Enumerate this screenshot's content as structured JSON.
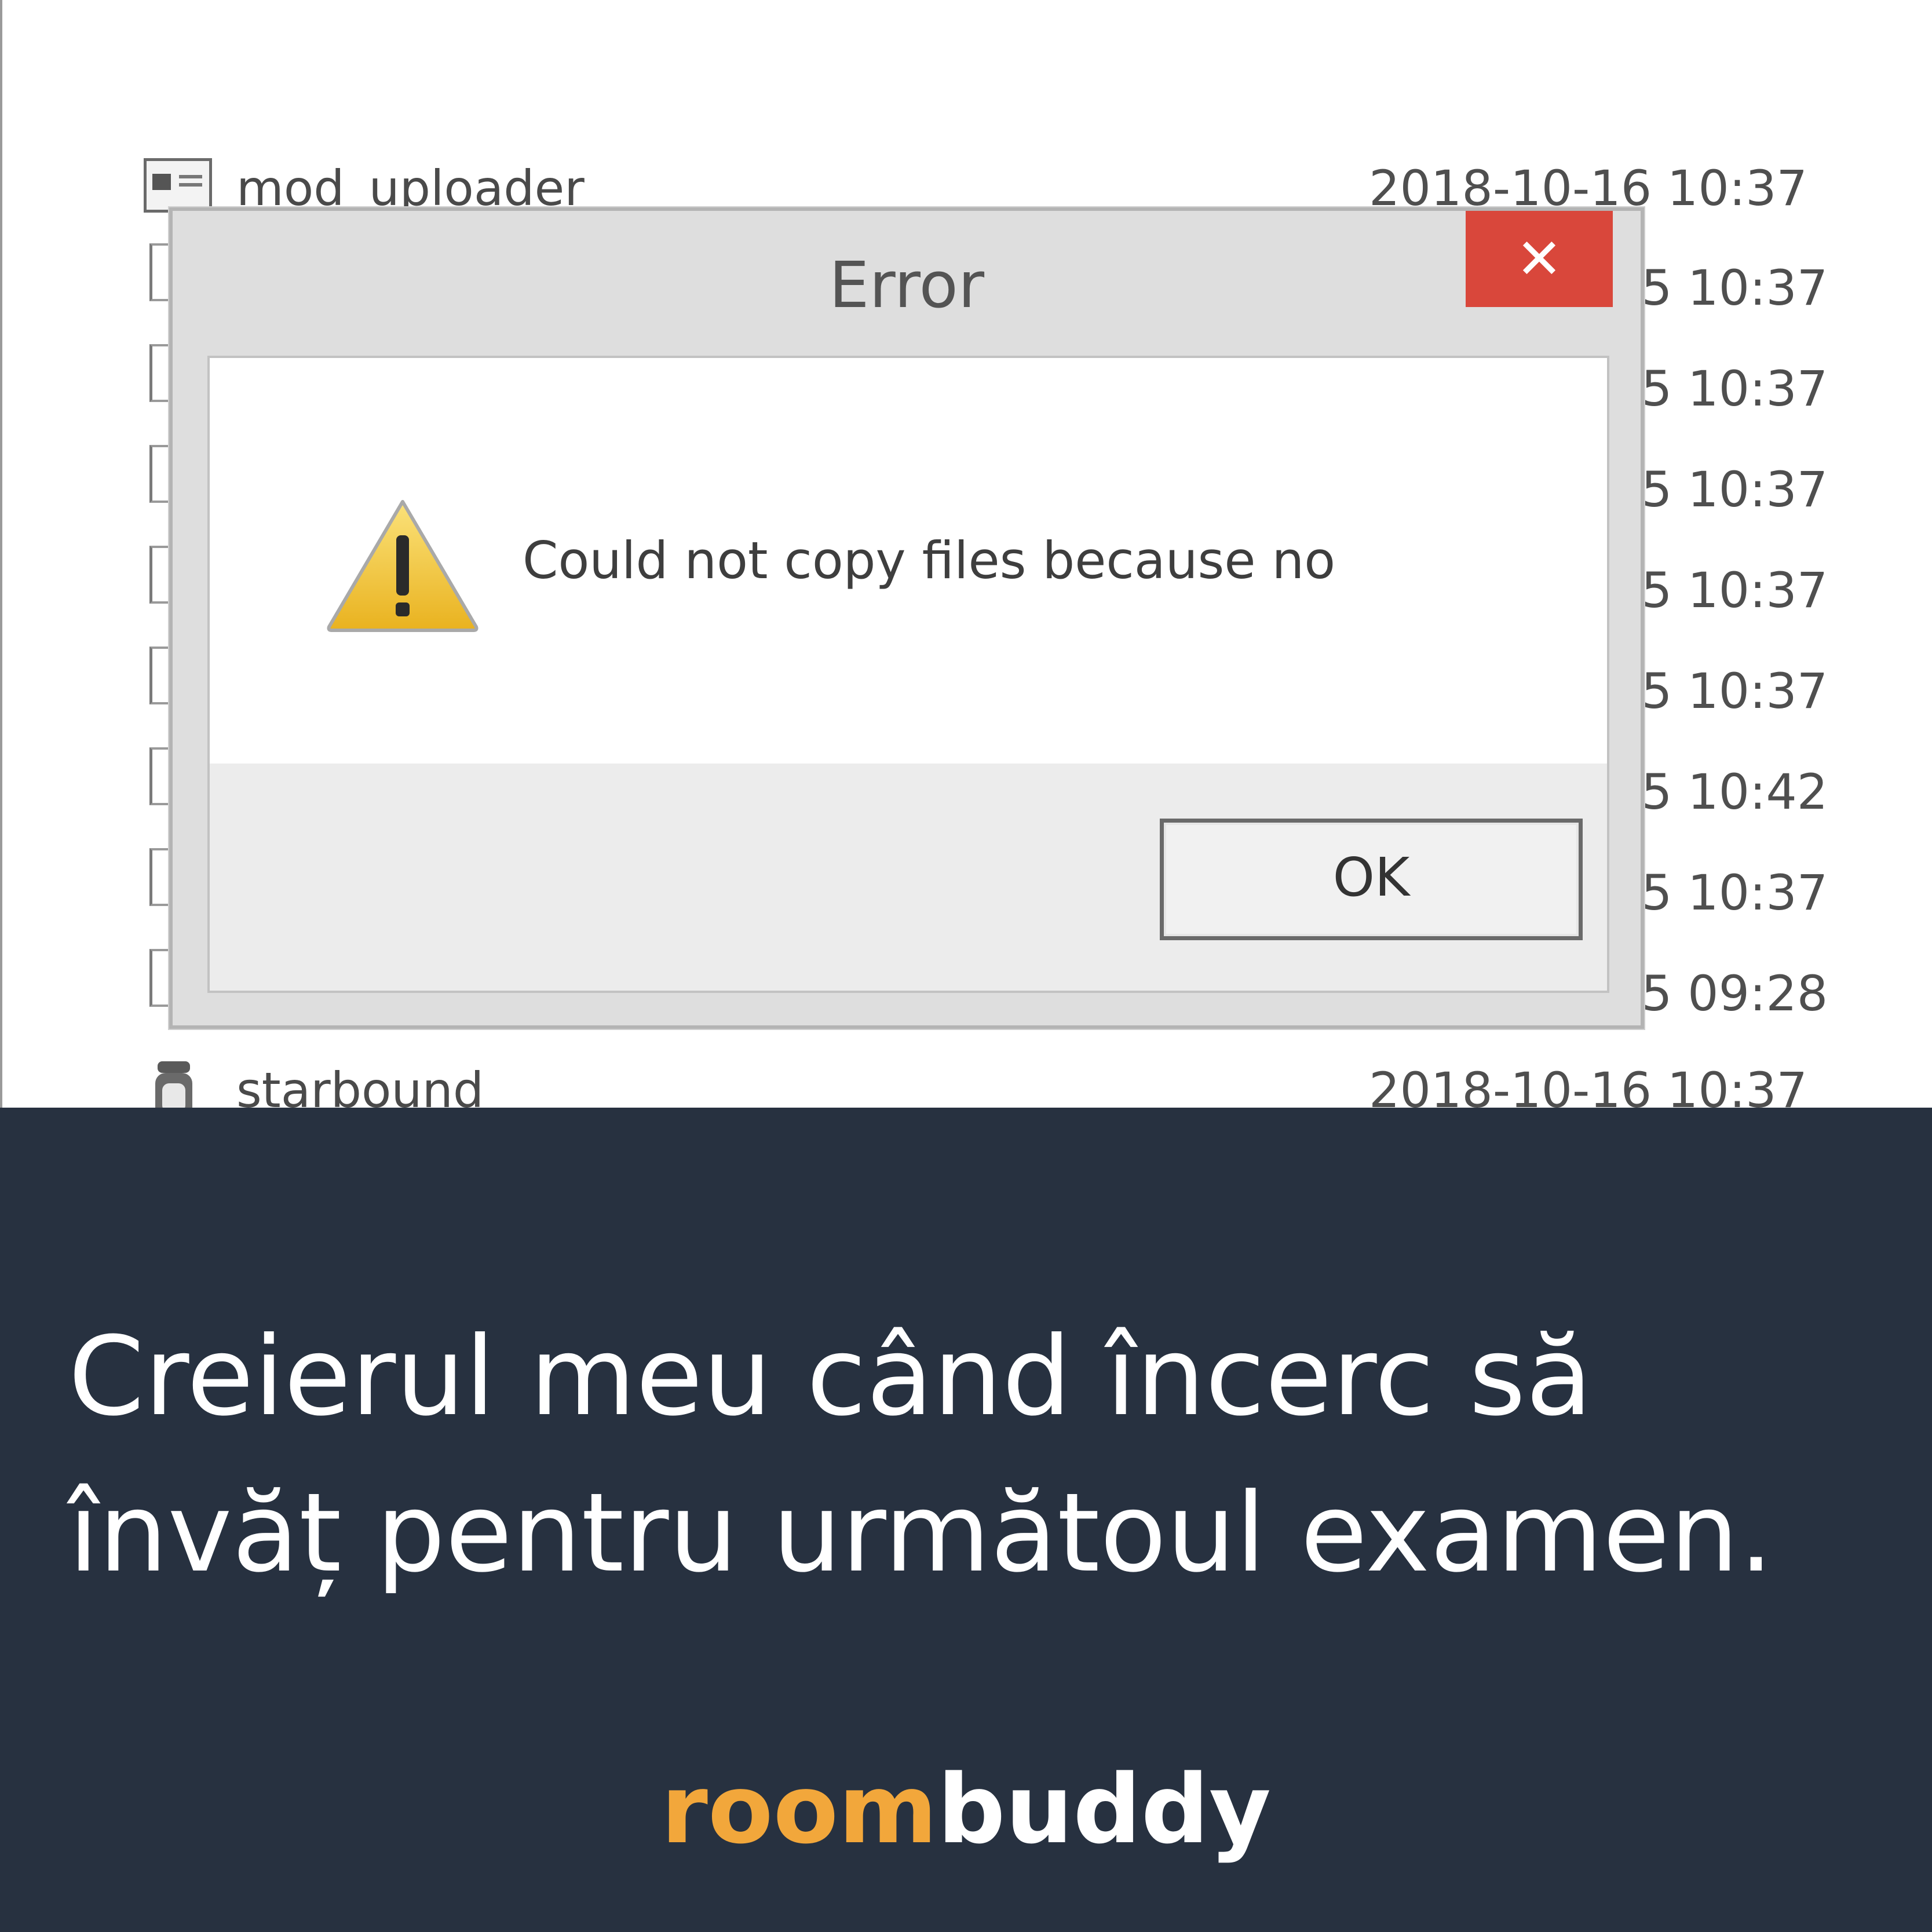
{
  "file_list": {
    "top_row": {
      "name": "mod_uploader",
      "date": "2018-10-16 10:37"
    },
    "bottom_row": {
      "name": "starbound",
      "date": "2018-10-16 10:37"
    },
    "partial_dates": [
      "5 10:37",
      "5 10:37",
      "5 10:37",
      "5 10:37",
      "5 10:37",
      "5 10:42",
      "5 10:37",
      "5 09:28"
    ]
  },
  "dialog": {
    "title": "Error",
    "close_glyph": "✕",
    "icon": "warning-icon",
    "message": "Could not copy files because no",
    "ok_label": "OK"
  },
  "caption": {
    "line1": "Creierul meu când încerc să",
    "line2": "învăț pentru următoul examen."
  },
  "brand": {
    "part1": "room",
    "part2": "buddy",
    "part1_color": "#f2a73b",
    "part2_color": "#ffffff",
    "panel_color": "#273140",
    "close_color": "#d9473b"
  }
}
